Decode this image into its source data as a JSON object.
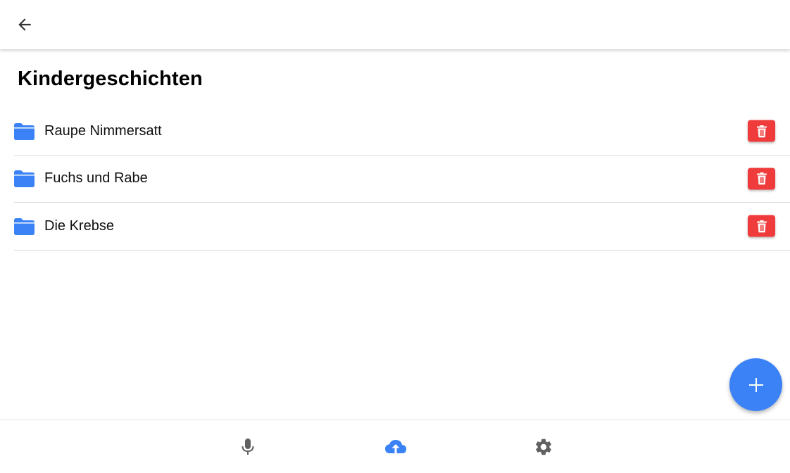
{
  "header": {
    "back_icon": "arrow-left-icon"
  },
  "page": {
    "title": "Kindergeschichten"
  },
  "folders": [
    {
      "label": "Raupe Nimmersatt",
      "icon": "folder-icon",
      "action_icon": "trash-icon"
    },
    {
      "label": "Fuchs und Rabe",
      "icon": "folder-icon",
      "action_icon": "trash-icon"
    },
    {
      "label": "Die Krebse",
      "icon": "folder-icon",
      "action_icon": "trash-icon"
    }
  ],
  "fab": {
    "icon": "plus-icon"
  },
  "bottom_nav": {
    "items": [
      {
        "icon": "microphone-icon",
        "active": false
      },
      {
        "icon": "cloud-upload-icon",
        "active": true
      },
      {
        "icon": "gear-icon",
        "active": false
      }
    ]
  },
  "colors": {
    "accent": "#3b82f6",
    "danger": "#ef3b3b",
    "icon_inactive": "#616161",
    "divider": "#dcdcdc"
  }
}
